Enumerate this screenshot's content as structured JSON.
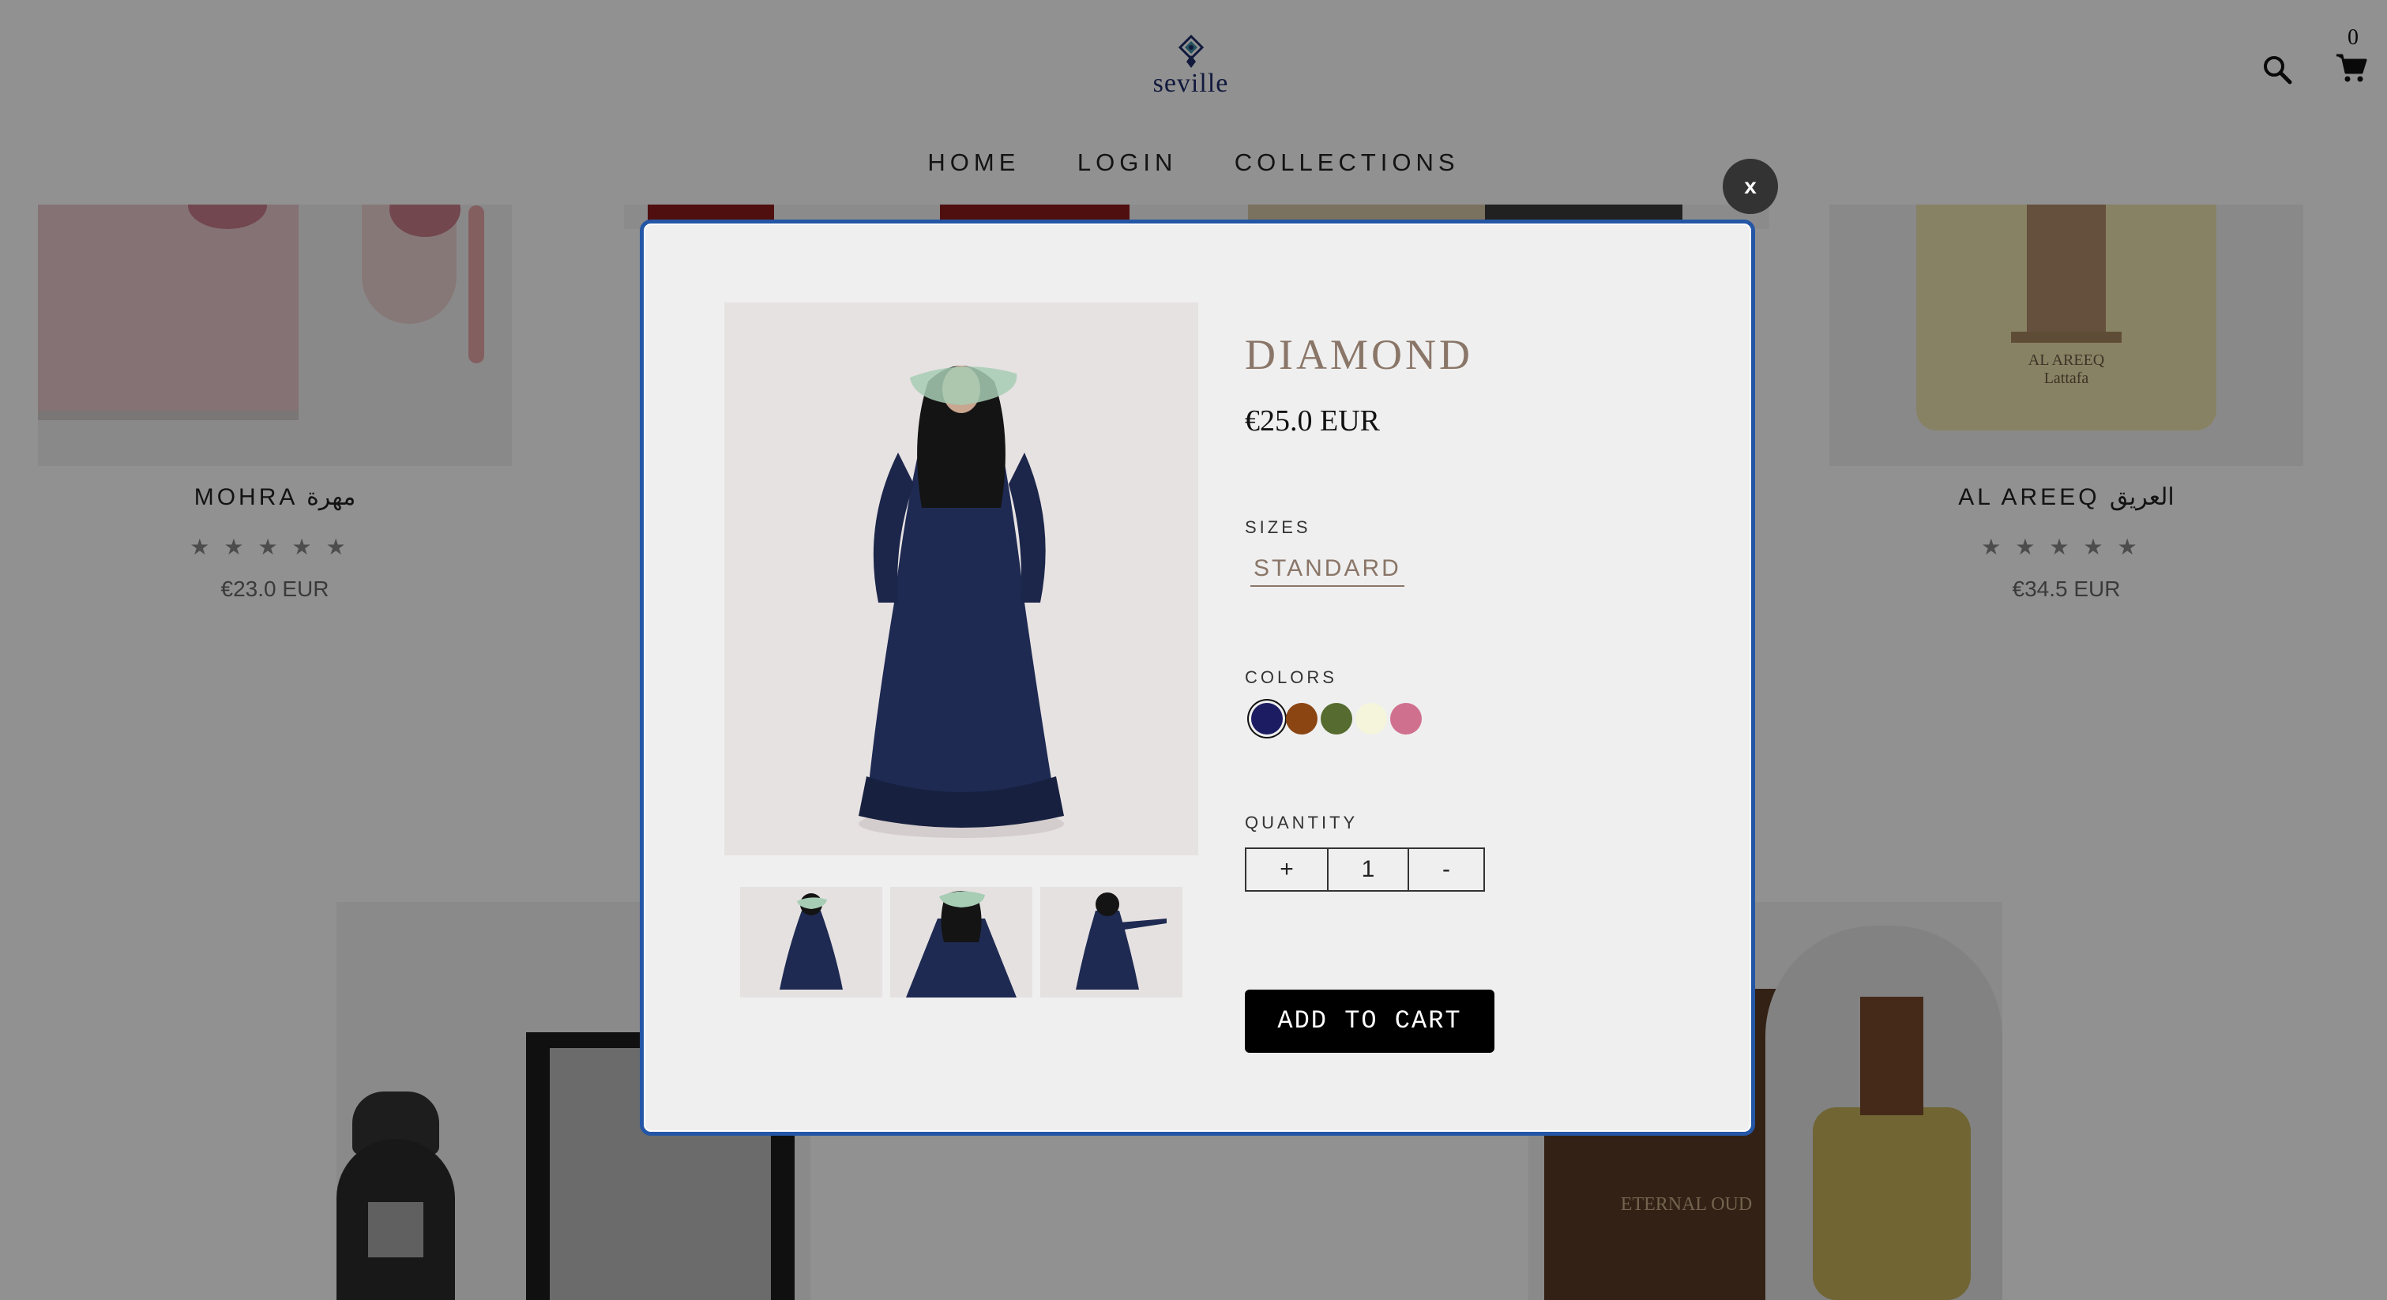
{
  "header": {
    "logo_text": "seville",
    "nav": [
      "HOME",
      "LOGIN",
      "COLLECTIONS"
    ],
    "cart_count": "0",
    "icons": [
      "search-icon",
      "cart-icon"
    ]
  },
  "background_products": [
    {
      "name": "MOHRA مهرة",
      "stars": "★★★★★",
      "price": "€23.0 EUR"
    },
    {
      "name": "AL AREEQ العريق",
      "stars": "★★★★★",
      "price": "€34.5 EUR"
    }
  ],
  "modal": {
    "close_label": "x",
    "title": "DIAMOND",
    "price": "€25.0 EUR",
    "sizes_label": "SIZES",
    "size_option": "STANDARD",
    "colors_label": "COLORS",
    "colors": [
      "#1c1c63",
      "#8b4513",
      "#556b2f",
      "#f5f5dc",
      "#d0708f"
    ],
    "selected_color_index": 0,
    "quantity_label": "QUANTITY",
    "qty_plus": "+",
    "quantity": "1",
    "qty_minus": "-",
    "add_to_cart": "ADD TO CART"
  }
}
